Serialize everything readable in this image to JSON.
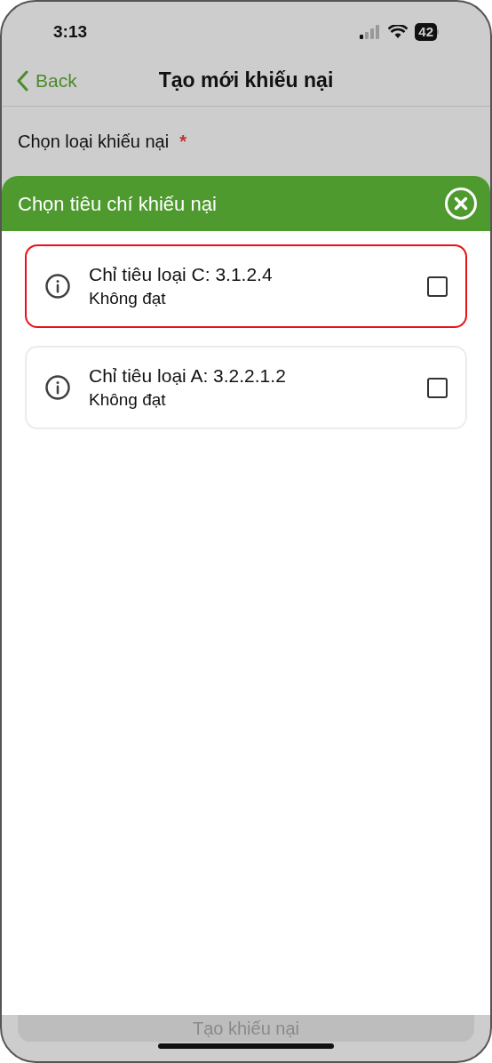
{
  "status_bar": {
    "time": "3:13",
    "battery": "42"
  },
  "nav": {
    "back": "Back",
    "title": "Tạo mới khiếu nại"
  },
  "form": {
    "label": "Chọn loại khiếu nại",
    "required_mark": "*"
  },
  "sheet": {
    "title": "Chọn tiêu chí khiếu nại",
    "items": [
      {
        "title": "Chỉ tiêu loại C: 3.1.2.4",
        "status": "Không đạt",
        "selected": true,
        "checked": false
      },
      {
        "title": "Chỉ tiêu loại A: 3.2.2.1.2",
        "status": "Không đạt",
        "selected": false,
        "checked": false
      }
    ]
  },
  "submit_button": "Tạo khiếu nại"
}
